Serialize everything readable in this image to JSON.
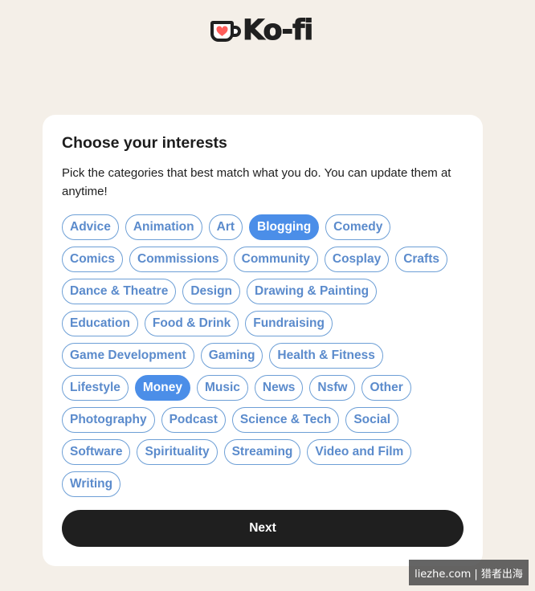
{
  "brand": {
    "name": "Ko-fi"
  },
  "card": {
    "title": "Choose your interests",
    "subtitle": "Pick the categories that best match what you do. You can update them at anytime!",
    "next_label": "Next"
  },
  "colors": {
    "background": "#f4efe8",
    "chip_border": "#6d9fd6",
    "chip_text": "#5b8bcc",
    "chip_selected": "#4b8ee8",
    "button": "#1f1f1f",
    "logo_red": "#ff5e5b"
  },
  "chip_rows": [
    [
      {
        "label": "Advice",
        "selected": false
      },
      {
        "label": "Animation",
        "selected": false
      },
      {
        "label": "Art",
        "selected": false
      },
      {
        "label": "Blogging",
        "selected": true
      },
      {
        "label": "Comedy",
        "selected": false
      }
    ],
    [
      {
        "label": "Comics",
        "selected": false
      },
      {
        "label": "Commissions",
        "selected": false
      },
      {
        "label": "Community",
        "selected": false
      },
      {
        "label": "Cosplay",
        "selected": false
      },
      {
        "label": "Crafts",
        "selected": false
      }
    ],
    [
      {
        "label": "Dance & Theatre",
        "selected": false
      },
      {
        "label": "Design",
        "selected": false
      },
      {
        "label": "Drawing & Painting",
        "selected": false
      }
    ],
    [
      {
        "label": "Education",
        "selected": false
      },
      {
        "label": "Food & Drink",
        "selected": false
      },
      {
        "label": "Fundraising",
        "selected": false
      }
    ],
    [
      {
        "label": "Game Development",
        "selected": false
      },
      {
        "label": "Gaming",
        "selected": false
      },
      {
        "label": "Health & Fitness",
        "selected": false
      }
    ],
    [
      {
        "label": "Lifestyle",
        "selected": false
      },
      {
        "label": "Money",
        "selected": true
      },
      {
        "label": "Music",
        "selected": false
      },
      {
        "label": "News",
        "selected": false
      },
      {
        "label": "Nsfw",
        "selected": false
      },
      {
        "label": "Other",
        "selected": false
      }
    ],
    [
      {
        "label": "Photography",
        "selected": false
      },
      {
        "label": "Podcast",
        "selected": false
      },
      {
        "label": "Science & Tech",
        "selected": false
      },
      {
        "label": "Social",
        "selected": false
      }
    ],
    [
      {
        "label": "Software",
        "selected": false
      },
      {
        "label": "Spirituality",
        "selected": false
      },
      {
        "label": "Streaming",
        "selected": false
      },
      {
        "label": "Video and Film",
        "selected": false
      }
    ],
    [
      {
        "label": "Writing",
        "selected": false
      }
    ]
  ],
  "watermark": {
    "text": "liezhe.com | 猎者出海"
  }
}
